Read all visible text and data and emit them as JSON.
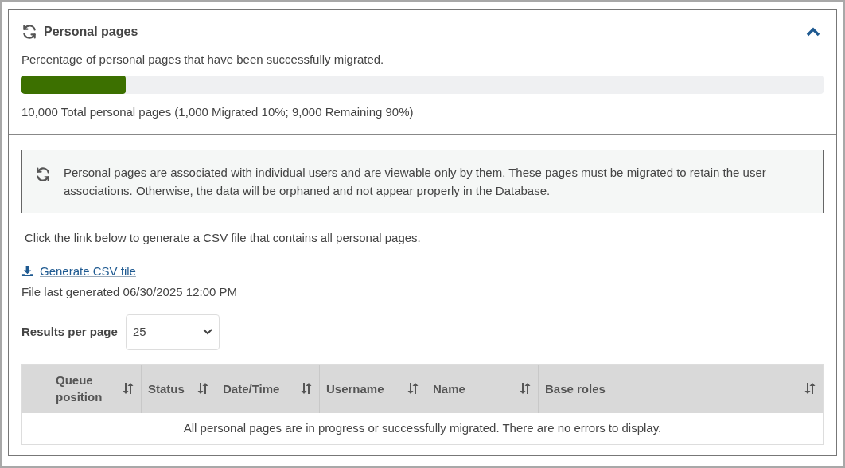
{
  "panel": {
    "title": "Personal pages",
    "expanded": true,
    "description": "Percentage of personal pages that have been successfully migrated.",
    "progress": {
      "level": 0.13
    },
    "summary": "10,000 Total personal pages (1,000 Migrated 10%; 9,000 Remaining 90%)"
  },
  "notice": "Personal pages are associated with individual users and are viewable only by them. These pages must be migrated to retain the user associations. Otherwise, the data will be orphaned and not appear properly in the Database.",
  "instruction": "Click the link below to generate a CSV file that contains all personal pages.",
  "generate_link": "Generate CSV file",
  "last_generated": "File last generated 06/30/2025 12:00 PM",
  "results_per_page": {
    "label": "Results per page",
    "value": "25"
  },
  "table": {
    "columns": [
      {
        "label": "Queue position"
      },
      {
        "label": "Status"
      },
      {
        "label": "Date/Time"
      },
      {
        "label": "Username"
      },
      {
        "label": "Name"
      },
      {
        "label": "Base roles"
      }
    ],
    "empty_message": "All personal pages are in progress or successfully migrated. There are no errors to display."
  }
}
